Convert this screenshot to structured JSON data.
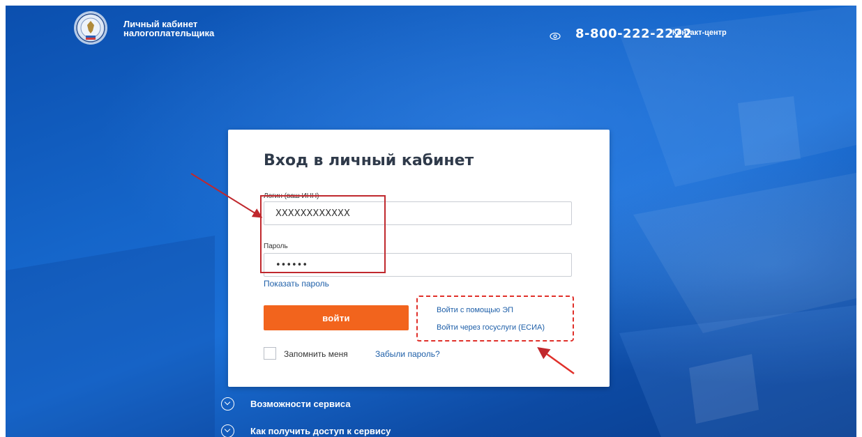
{
  "header": {
    "brand_line1": "Личный кабинет",
    "brand_line2": "налогоплательщика",
    "phone": "8-800-222-2222",
    "contact_label": "Контакт-центр",
    "eye_icon": "eye-icon"
  },
  "login": {
    "title": "Вход в личный кабинет",
    "login_label": "Логин (ваш ИНН)",
    "login_value": "XXXXXXXXXXXX",
    "password_label": "Пароль",
    "password_value": "••••••",
    "show_password": "Показать пароль",
    "submit_label": "войти",
    "alt_ep": "Войти с помощью ЭП",
    "alt_esia": "Войти через госуслуги (ЕСИА)",
    "remember_label": "Запомнить меня",
    "forgot_label": "Забыли пароль?"
  },
  "accordion": [
    {
      "label": "Возможности сервиса"
    },
    {
      "label": "Как получить доступ к сервису"
    }
  ],
  "colors": {
    "accent": "#f2641d",
    "link": "#1e5fa8",
    "annotation_red": "#c0282d",
    "background_blue": "#1565c9"
  }
}
